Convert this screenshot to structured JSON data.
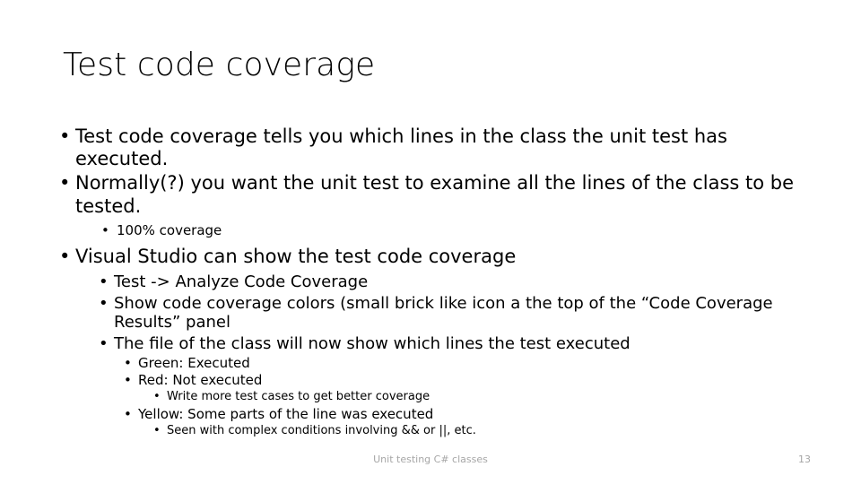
{
  "slide": {
    "title": "Test code coverage",
    "bullet_glyph": "•",
    "text_color": "#000000",
    "background_color": "#ffffff",
    "footer_color": "#a6a6a6",
    "footer": "Unit testing C# classes",
    "slide_number": "13",
    "content": [
      {
        "level": 1,
        "text": "Test code coverage tells you which lines in the class the unit test has executed."
      },
      {
        "level": 1,
        "text": "Normally(?) you want the unit test to examine all the lines of the class to be tested."
      },
      {
        "level": 2,
        "small": true,
        "text": "100% coverage"
      },
      {
        "level": 1,
        "text": "Visual Studio can show the test code coverage"
      },
      {
        "level": 2,
        "text": "Test -> Analyze Code Coverage"
      },
      {
        "level": 2,
        "text": "Show code coverage colors (small brick like icon a the top of the “Code Coverage Results” panel"
      },
      {
        "level": 2,
        "text": "The file of the class will now show which lines the test executed"
      },
      {
        "level": 3,
        "text": "Green: Executed"
      },
      {
        "level": 3,
        "text": "Red: Not executed"
      },
      {
        "level": 4,
        "text": "Write more test cases to get better coverage"
      },
      {
        "level": 3,
        "text": "Yellow: Some parts of the line was executed"
      },
      {
        "level": 4,
        "text": "Seen with complex conditions involving && or ||, etc."
      }
    ]
  }
}
